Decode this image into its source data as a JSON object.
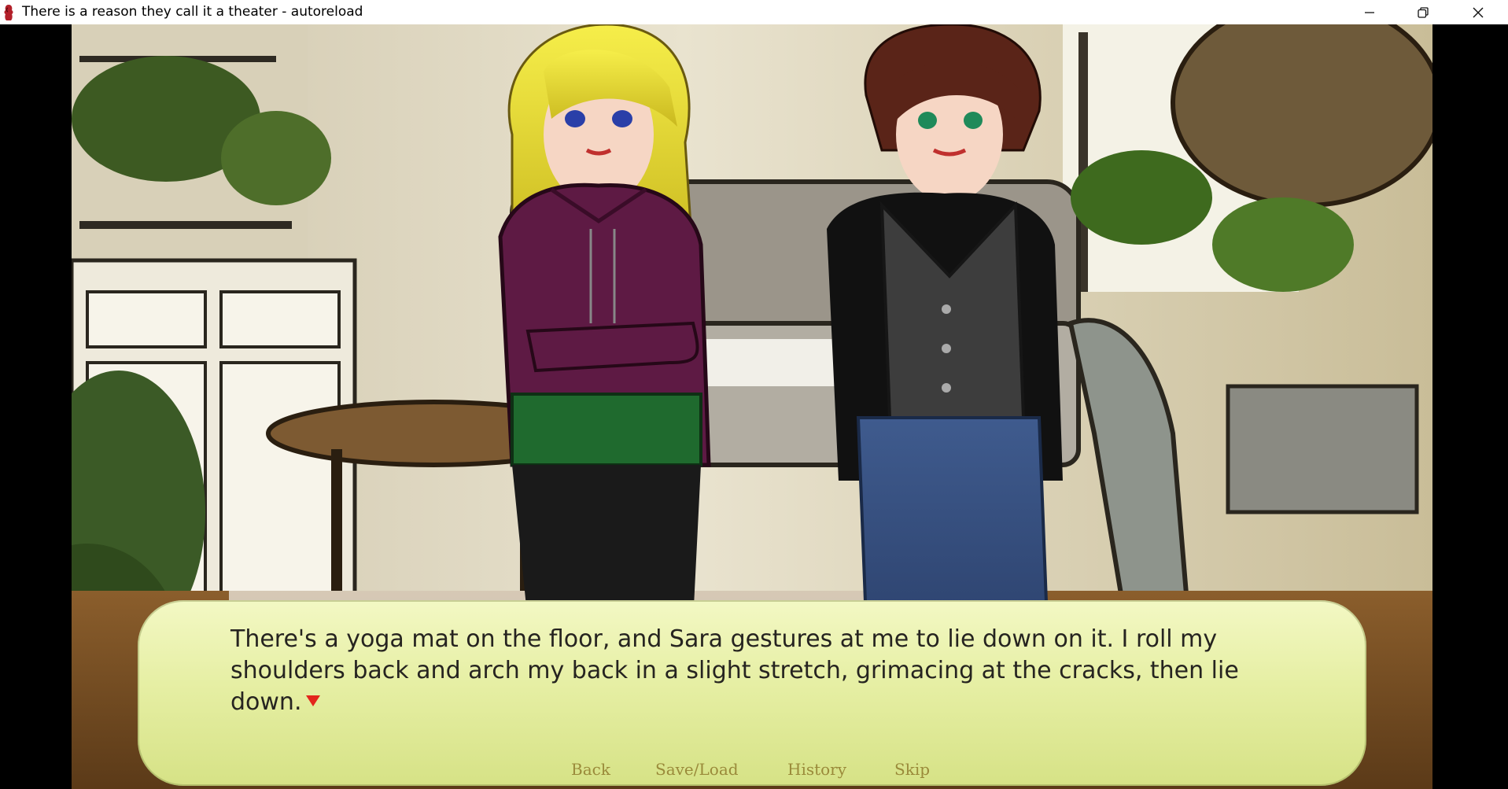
{
  "window": {
    "title": "There is a reason they call it a theater - autoreload",
    "buttons": [
      "minimize",
      "restore",
      "close"
    ]
  },
  "dialogue": {
    "text": "There's a yoga mat on the floor, and Sara gestures at me to lie down on it. I roll my shoulders back and arch my back in a slight stretch, grimacing at the cracks, then lie down."
  },
  "quick_menu": {
    "items": [
      {
        "label": "Back"
      },
      {
        "label": "Save/Load"
      },
      {
        "label": "History"
      },
      {
        "label": "Skip"
      }
    ]
  },
  "icons": {
    "app": "app-icon",
    "minimize": "minimize-icon",
    "restore": "restore-icon",
    "close": "close-icon",
    "continue": "continue-indicator-icon"
  },
  "colors": {
    "dialogue_bg": "#e6efa4",
    "quick_menu_text": "#9a8a3a",
    "continue_indicator": "#e3261c",
    "hoodie": "#5e1a44",
    "vest": "#3d3d3d"
  }
}
